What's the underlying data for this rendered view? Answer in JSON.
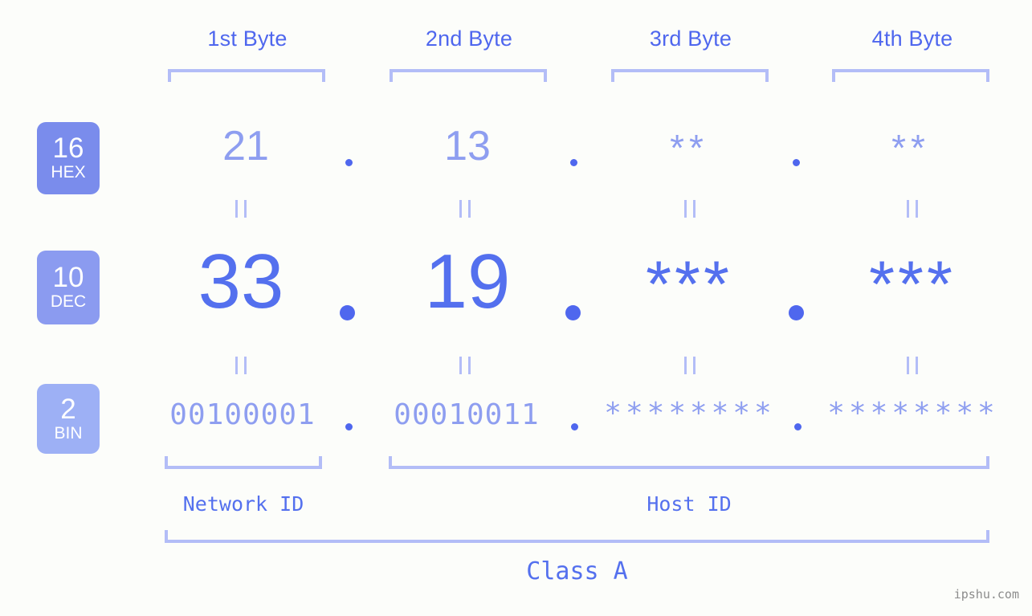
{
  "theme": {
    "background": "#fcfdfa",
    "accent_strong": "#4f67ee",
    "accent_mid": "#8e9ef0",
    "accent_light": "#b3bdf7",
    "badge_hex_bg": "#7a8cec",
    "badge_dec_bg": "#8b9bf0",
    "badge_bin_bg": "#9db0f5",
    "watermark_color": "#8c8c8c"
  },
  "header": {
    "bytes": [
      {
        "label": "1st Byte"
      },
      {
        "label": "2nd Byte"
      },
      {
        "label": "3rd Byte"
      },
      {
        "label": "4th Byte"
      }
    ]
  },
  "bases": [
    {
      "id": "hex",
      "number": "16",
      "name": "HEX"
    },
    {
      "id": "dec",
      "number": "10",
      "name": "DEC"
    },
    {
      "id": "bin",
      "number": "2",
      "name": "BIN"
    }
  ],
  "separator": ".",
  "rows": {
    "hex": {
      "base_number": "16",
      "base_name": "HEX",
      "values": [
        "21",
        "13",
        "**",
        "**"
      ]
    },
    "dec": {
      "base_number": "10",
      "base_name": "DEC",
      "values": [
        "33",
        "19",
        "***",
        "***"
      ]
    },
    "bin": {
      "base_number": "2",
      "base_name": "BIN",
      "values": [
        "00100001",
        "00010011",
        "********",
        "********"
      ]
    }
  },
  "sections": {
    "network_id": "Network ID",
    "host_id": "Host ID",
    "class": "Class A"
  },
  "watermark": "ipshu.com",
  "chart_data": {
    "type": "table",
    "title": "IP address byte breakdown",
    "columns": [
      "1st Byte",
      "2nd Byte",
      "3rd Byte",
      "4th Byte"
    ],
    "rows": [
      {
        "base": "16 HEX",
        "cells": [
          "21",
          "13",
          "**",
          "**"
        ]
      },
      {
        "base": "10 DEC",
        "cells": [
          "33",
          "19",
          "***",
          "***"
        ]
      },
      {
        "base": "2 BIN",
        "cells": [
          "00100001",
          "00010011",
          "********",
          "********"
        ]
      }
    ],
    "annotations": {
      "network_id_spans_bytes": 1,
      "host_id_spans_bytes": 3,
      "class": "Class A"
    }
  }
}
